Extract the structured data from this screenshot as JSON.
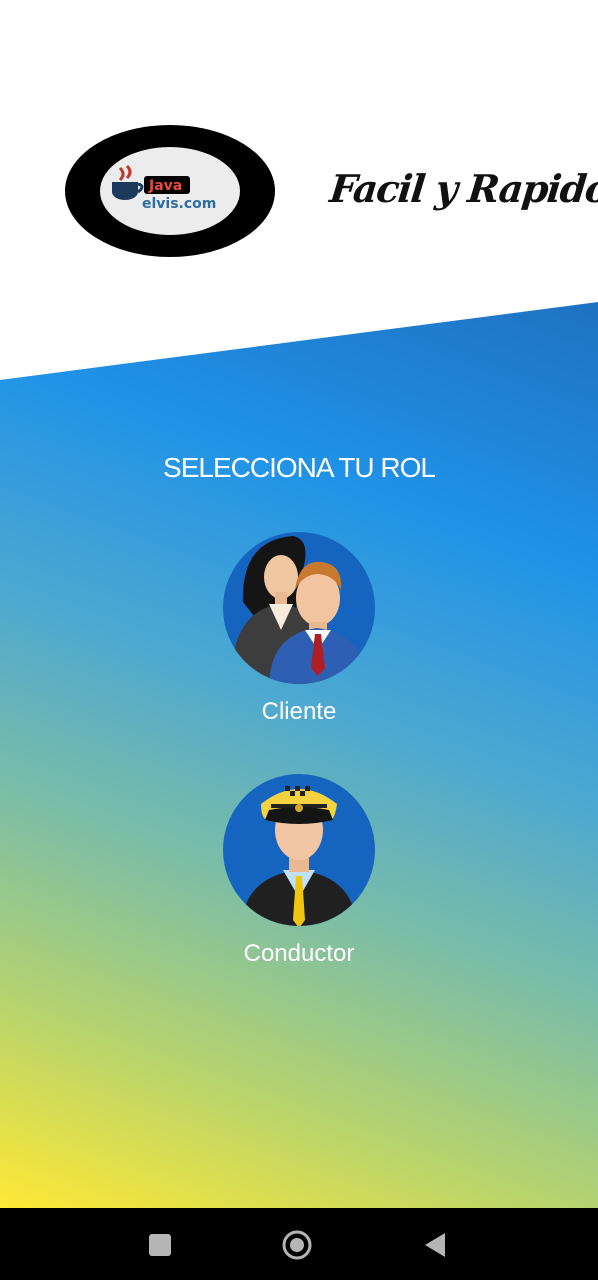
{
  "header": {
    "logo_text_top": "Java",
    "logo_text_bottom": "elvis.com",
    "slogan": "Facil y Rapido"
  },
  "main": {
    "heading": "SELECCIONA TU ROL",
    "roles": [
      {
        "label": "Cliente",
        "icon": "client-avatar-icon"
      },
      {
        "label": "Conductor",
        "icon": "driver-avatar-icon"
      }
    ]
  },
  "navbar": {
    "recents_icon": "square-icon",
    "home_icon": "circle-icon",
    "back_icon": "triangle-back-icon"
  },
  "colors": {
    "gradient_top": "#1d4f7c",
    "gradient_mid": "#1f92e8",
    "gradient_bottom": "#ffe834",
    "avatar_bg": "#1565c0",
    "navbar_bg": "#000000"
  }
}
